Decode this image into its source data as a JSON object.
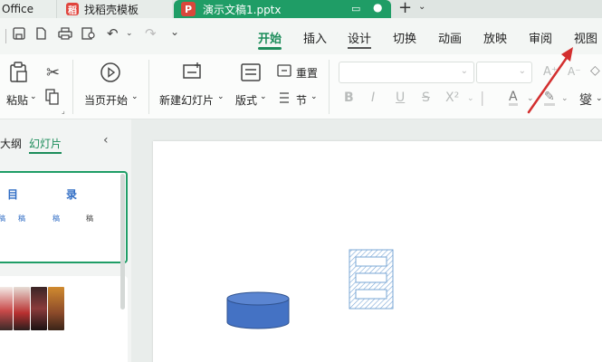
{
  "tabs": {
    "office": "Office",
    "template": "找稻壳模板",
    "document": "演示文稿1.pptx",
    "doc_icon": "P",
    "template_icon": "稻"
  },
  "menu": [
    "开始",
    "插入",
    "设计",
    "切换",
    "动画",
    "放映",
    "审阅",
    "视图"
  ],
  "ribbon": {
    "paste": "粘贴",
    "play_current": "当页开始",
    "new_slide": "新建幻灯片",
    "layout": "版式",
    "reset": "重置",
    "section": "节",
    "font_combo": "",
    "size_combo": "",
    "format_buttons": [
      "B",
      "I",
      "U",
      "S",
      "X²",
      "A"
    ],
    "font_size_up": "A⁺",
    "font_size_down": "A⁻",
    "pinyin": "燮"
  },
  "left_panel": {
    "tab_outline": "大纲",
    "tab_slides": "幻灯片",
    "thumb1_title_a": "目",
    "thumb1_title_b": "录",
    "thumb1_sub": [
      "稿",
      "稿",
      "稿",
      "稿"
    ]
  },
  "colors": {
    "accent": "#1c8c5a",
    "doc_tab": "#1f9d66",
    "cylinder": "#4472c4",
    "arrow": "#d32f2f"
  },
  "icons": {
    "save": "save-icon",
    "print": "print-icon",
    "undo": "undo-icon",
    "redo": "redo-icon",
    "play": "play-icon",
    "cut": "cut-icon",
    "copy": "copy-icon"
  }
}
